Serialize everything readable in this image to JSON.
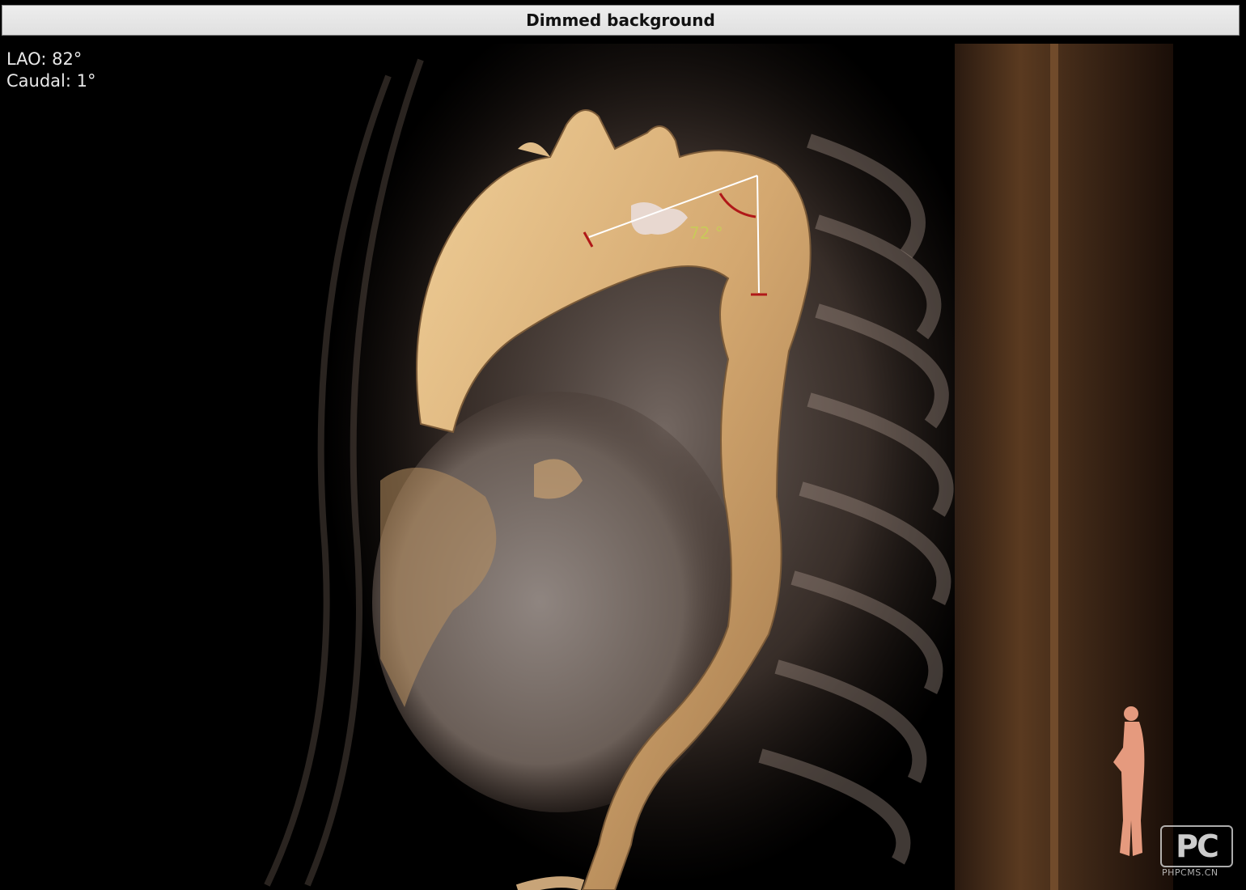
{
  "window": {
    "title": "Dimmed background"
  },
  "viewport": {
    "orientation": {
      "lao": "LAO: 82°",
      "caudal": "Caudal: 1°"
    },
    "measurement": {
      "angle_label": "72 °"
    },
    "watermark": {
      "logo": "PC",
      "text": "PHPCMS.CN"
    },
    "icons": [
      "body-orientation-figure-icon"
    ]
  },
  "colors": {
    "background": "#000000",
    "vessel": "#d9b47e",
    "tissue": "#8a7a70",
    "measure_line": "#ffffff",
    "measure_marker": "#b01818",
    "angle_text": "#c9c95a"
  }
}
